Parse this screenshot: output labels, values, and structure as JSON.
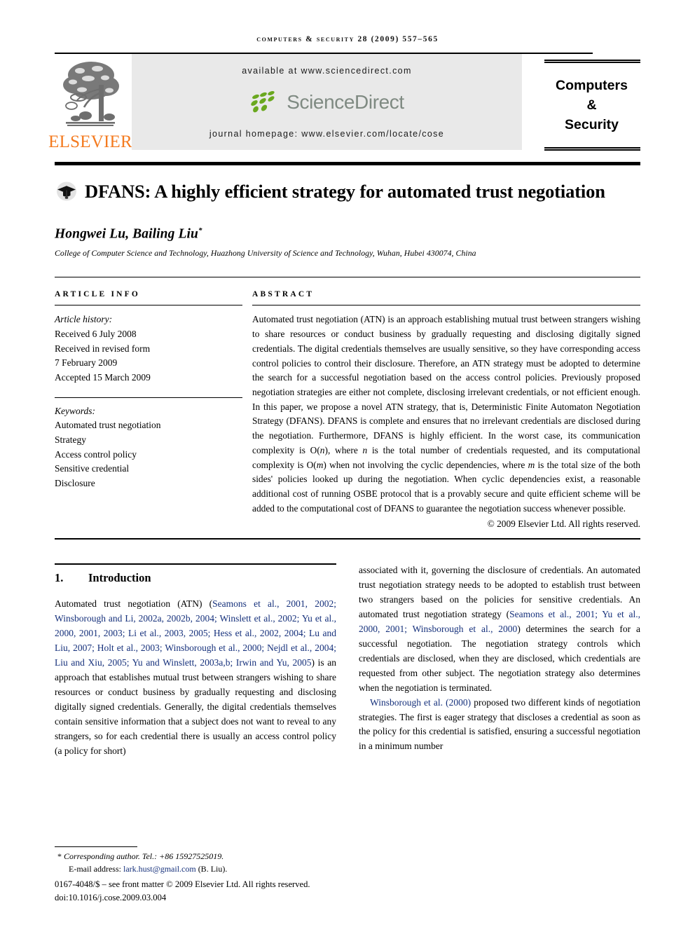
{
  "running_head": "Computers & Security 28 (2009) 557–565",
  "masthead": {
    "publisher_name": "ELSEVIER",
    "publisher_logo_icon": "elsevier-tree-logo",
    "available_at": "available at www.sciencedirect.com",
    "sciencedirect_wordmark": "ScienceDirect",
    "sciencedirect_leaf_icon": "sciencedirect-leaves-icon",
    "journal_homepage": "journal homepage: www.elsevier.com/locate/cose",
    "journal_title_lines": [
      "Computers",
      "&",
      "Security"
    ],
    "band_color": "#e9e9e9",
    "elsevier_orange": "#f47b20",
    "sciencedirect_green": "#6aa81f",
    "sciencedirect_gray": "#7f8a82"
  },
  "article": {
    "title_icon": "graduation-cap-icon",
    "title": "DFANS: A highly efficient strategy for automated trust negotiation",
    "authors": "Hongwei Lu, Bailing Liu",
    "author_marker": "*",
    "affiliation": "College of Computer Science and Technology, Huazhong University of Science and Technology, Wuhan, Hubei 430074, China"
  },
  "article_info": {
    "heading": "ARTICLE INFO",
    "history_label": "Article history:",
    "history": [
      "Received 6 July 2008",
      "Received in revised form",
      "7 February 2009",
      "Accepted 15 March 2009"
    ],
    "keywords_label": "Keywords:",
    "keywords": [
      "Automated trust negotiation",
      "Strategy",
      "Access control policy",
      "Sensitive credential",
      "Disclosure"
    ]
  },
  "abstract": {
    "heading": "ABSTRACT",
    "paragraph_part1": "Automated trust negotiation (ATN) is an approach establishing mutual trust between strangers wishing to share resources or conduct business by gradually requesting and disclosing digitally signed credentials. The digital credentials themselves are usually sensitive, so they have corresponding access control policies to control their disclosure. Therefore, an ATN strategy must be adopted to determine the search for a successful negotiation based on the access control policies. Previously proposed negotiation strategies are either not complete, disclosing irrelevant credentials, or not efficient enough. In this paper, we propose a novel ATN strategy, that is, Deterministic Finite Automaton Negotiation Strategy (DFANS). DFANS is complete and ensures that no irrelevant credentials are disclosed during the negotiation. Furthermore, DFANS is highly efficient. In the worst case, its communication complexity is O(",
    "var_n_1": "n",
    "paragraph_part2": "), where ",
    "var_n_2": "n",
    "paragraph_part3": " is the total number of credentials requested, and its computational complexity is O(",
    "var_m_1": "m",
    "paragraph_part4": ") when not involving the cyclic dependencies, where ",
    "var_m_2": "m",
    "paragraph_part5": " is the total size of the both sides' policies looked up during the negotiation. When cyclic dependencies exist, a reasonable additional cost of running OSBE protocol that is a provably secure and quite efficient scheme will be added to the computational cost of DFANS to guarantee the negotiation success whenever possible.",
    "copyright": "© 2009 Elsevier Ltd. All rights reserved."
  },
  "section": {
    "number": "1.",
    "title": "Introduction"
  },
  "body": {
    "left_para1_a": "Automated trust negotiation (ATN) (",
    "left_para1_cite": "Seamons et al., 2001, 2002; Winsborough and Li, 2002a, 2002b, 2004; Winslett et al., 2002; Yu et al., 2000, 2001, 2003; Li et al., 2003, 2005; Hess et al., 2002, 2004; Lu and Liu, 2007; Holt et al., 2003; Winsborough et al., 2000; Nejdl et al., 2004; Liu and Xiu, 2005; Yu and Winslett, 2003a,b; Irwin and Yu, 2005",
    "left_para1_b": ") is an approach that establishes mutual trust between strangers wishing to share resources or conduct business by gradually requesting and disclosing digitally signed credentials. Generally, the digital credentials themselves contain sensitive information that a subject does not want to reveal to any strangers, so for each credential there is usually an access control policy (a policy for short)",
    "right_para1_a": "associated with it, governing the disclosure of credentials. An automated trust negotiation strategy needs to be adopted to establish trust between two strangers based on the policies for sensitive credentials. An automated trust negotiation strategy (",
    "right_para1_cite": "Seamons et al., 2001; Yu et al., 2000, 2001; Winsborough et al., 2000",
    "right_para1_b": ") determines the search for a successful negotiation. The negotiation strategy controls which credentials are disclosed, when they are disclosed, which credentials are requested from other subject. The negotiation strategy also determines when the negotiation is terminated.",
    "right_para2_cite": "Winsborough et al. (2000)",
    "right_para2_b": " proposed two different kinds of negotiation strategies. The first is eager strategy that discloses a credential as soon as the policy for this credential is satisfied, ensuring a successful negotiation in a minimum number"
  },
  "footnote": {
    "star": "*",
    "corresponding": "Corresponding author. Tel.: +86 15927525019.",
    "email_label": "E-mail address:",
    "email_address": "lark.hust@gmail.com",
    "email_suffix": "(B. Liu).",
    "front_matter": "0167-4048/$ – see front matter © 2009 Elsevier Ltd. All rights reserved.",
    "doi": "doi:10.1016/j.cose.2009.03.004",
    "link_color": "#15307b"
  }
}
